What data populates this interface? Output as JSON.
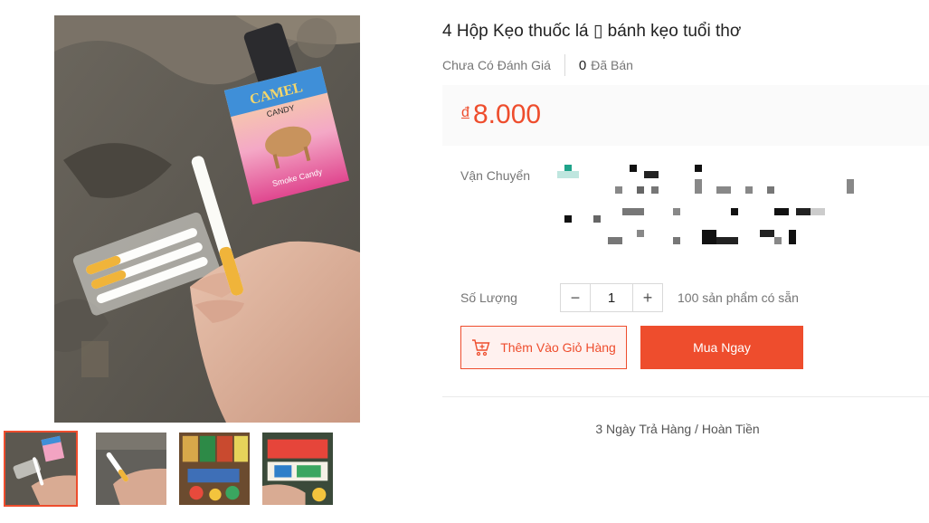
{
  "product": {
    "title": "4 Hộp Kẹo thuốc lá ▯ bánh kẹo tuổi thơ",
    "rating_text": "Chưa Có Đánh Giá",
    "sold_count": "0",
    "sold_label": "Đã Bán"
  },
  "price": {
    "currency": "đ",
    "amount": "8.000"
  },
  "shipping": {
    "label": "Vận Chuyển"
  },
  "quantity": {
    "label": "Số Lượng",
    "value": "1",
    "decrease": "−",
    "increase": "+",
    "stock_text": "100 sản phẩm có sẵn"
  },
  "actions": {
    "add_to_cart": "Thêm Vào Giỏ Hàng",
    "buy_now": "Mua Ngay"
  },
  "policy": {
    "returns": "3 Ngày Trả Hàng / Hoàn Tiền"
  },
  "main_image": {
    "box_brand": "CAMEL",
    "box_sub": "CANDY",
    "box_bottom": "Smoke Candy"
  },
  "gallery": {
    "selected_index": 0,
    "thumbnails": [
      "thumb-candy-box-hand",
      "thumb-candy-stick-hand",
      "thumb-candy-shelf",
      "thumb-candy-packs"
    ]
  },
  "colors": {
    "accent": "#ee4d2d",
    "cart_bg": "#fff1ef",
    "price_bg": "#fafafa"
  }
}
